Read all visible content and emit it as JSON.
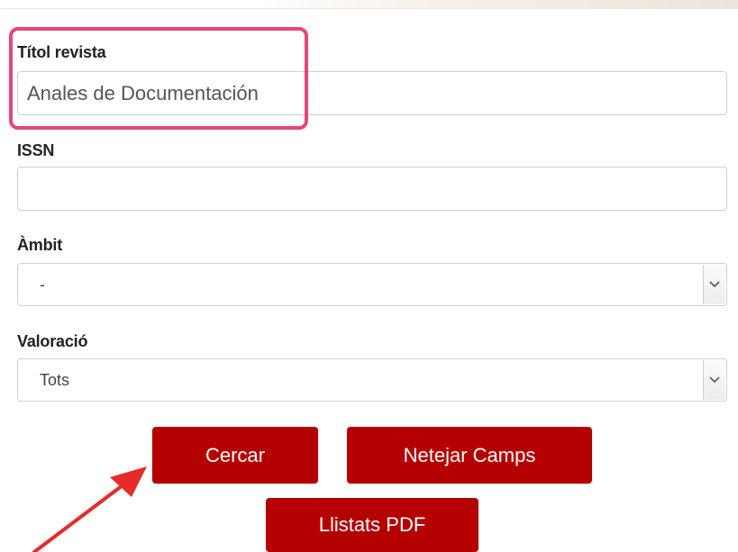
{
  "form": {
    "title_label": "Títol revista",
    "title_value": "Anales de Documentación",
    "issn_label": "ISSN",
    "issn_value": "",
    "ambit_label": "Àmbit",
    "ambit_selected": "-",
    "valoracio_label": "Valoració",
    "valoracio_selected": "Tots"
  },
  "buttons": {
    "search_label": "Cercar",
    "clear_label": "Netejar Camps",
    "pdf_label": "Llistats PDF"
  },
  "icons": {
    "select_arrow": "chevron-down-icon",
    "annotation_arrow": "arrow-icon"
  },
  "colors": {
    "button_bg": "#b50000",
    "highlight": "#e8457a",
    "arrow": "#e52b2b"
  }
}
